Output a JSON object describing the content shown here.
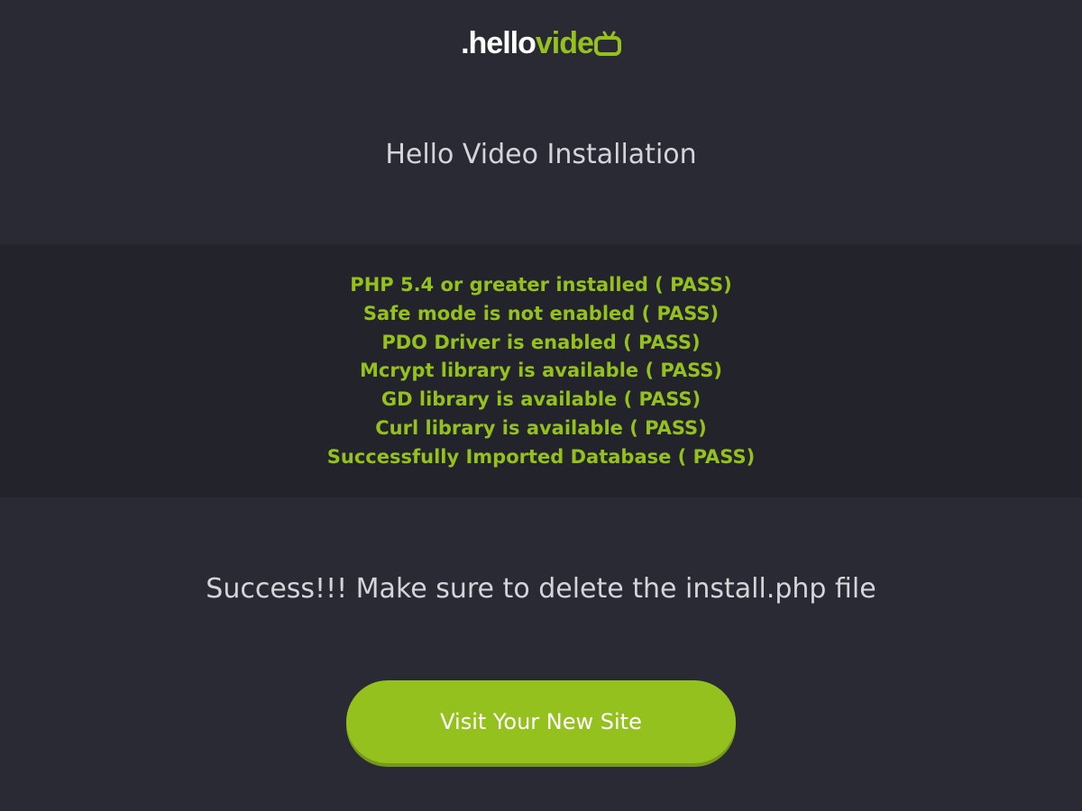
{
  "logo": {
    "part1": ".hello",
    "part2": "vide",
    "icon": "tv-icon"
  },
  "page_title": "Hello Video Installation",
  "checks": [
    "PHP 5.4 or greater installed ( PASS)",
    "Safe mode is not enabled ( PASS)",
    "PDO Driver is enabled ( PASS)",
    "Mcrypt library is available ( PASS)",
    "GD library is available ( PASS)",
    "Curl library is available ( PASS)",
    "Successfully Imported Database ( PASS)"
  ],
  "success_message": "Success!!! Make sure to delete the install.php file",
  "visit_button": "Visit Your New Site",
  "colors": {
    "background": "#292a33",
    "panel": "#22232b",
    "accent": "#95c11f",
    "text": "#d4d5da"
  }
}
